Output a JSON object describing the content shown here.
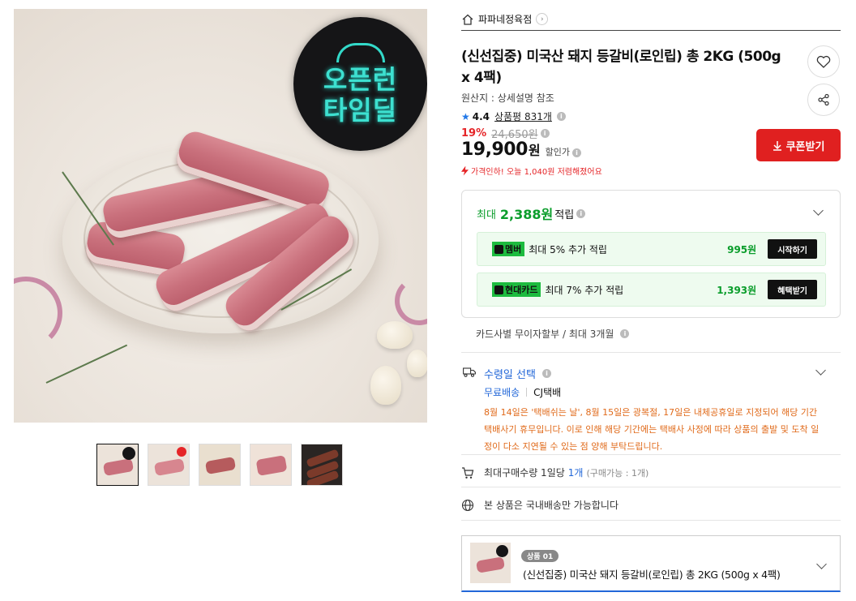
{
  "gallery": {
    "badge_lines": [
      "오픈런",
      "타임딜"
    ],
    "thumbnail_count": 5,
    "active_thumbnail": 1
  },
  "store": {
    "name": "파파네정육점",
    "home_icon": "home-icon",
    "arrow_icon": "chevron-right-icon"
  },
  "product": {
    "title": "(신선집중) 미국산 돼지 등갈비(로인립) 총 2KG (500g x 4팩)",
    "origin": "원산지 : 상세설명 참조",
    "rating": "4.4",
    "reviews_label": "상품평 831개",
    "discount_pct": "19%",
    "original_price": "24,650원",
    "price": "19,900",
    "price_unit": "원",
    "price_label": "할인가",
    "price_drop_note": "가격인하! 오늘 1,040원 저렴해졌어요"
  },
  "actions": {
    "like_icon": "heart-icon",
    "share_icon": "share-icon",
    "coupon_label": "쿠폰받기"
  },
  "rewards": {
    "head_prefix": "최대",
    "head_amount": "2,388원",
    "head_suffix": "적립",
    "items": [
      {
        "tag": "멤버",
        "text": "최대 5% 추가 적립",
        "amount": "995원",
        "action": "시작하기"
      },
      {
        "tag": "현대카드",
        "text": "최대 7% 추가 적립",
        "amount": "1,393원",
        "action": "혜택받기"
      }
    ]
  },
  "installment": "카드사별 무이자할부 / 최대 3개월",
  "delivery": {
    "title": "수령일 선택",
    "free_label": "무료배송",
    "carrier": "CJ택배",
    "holiday_notice": "8월 14일은 '택배쉬는 날', 8월 15일은 광복절, 17일은 내체공휴일로 지정되어 해당 기간 택배사기 휴무입니다. 이로 인해 해당 기간에는 택배사 사정에 따라 상품의 출발 및 도착 일정이 다소 지연될 수 있는 점 양해 부탁드립니다."
  },
  "quantity": {
    "prefix": "최대구매수량 1일당",
    "value": "1개",
    "sub": "(구매가능 : 1개)"
  },
  "region_notice": "본 상품은 국내배송만 가능합니다",
  "option": {
    "badge": "상품 01",
    "name": "(신선집중) 미국산 돼지 등갈비(로인립) 총 2KG (500g x 4팩)"
  },
  "colors": {
    "accent_red": "#e02020",
    "reward_green": "#0a9d2b",
    "link_blue": "#2267d8",
    "notice_orange": "#e06a1a"
  }
}
